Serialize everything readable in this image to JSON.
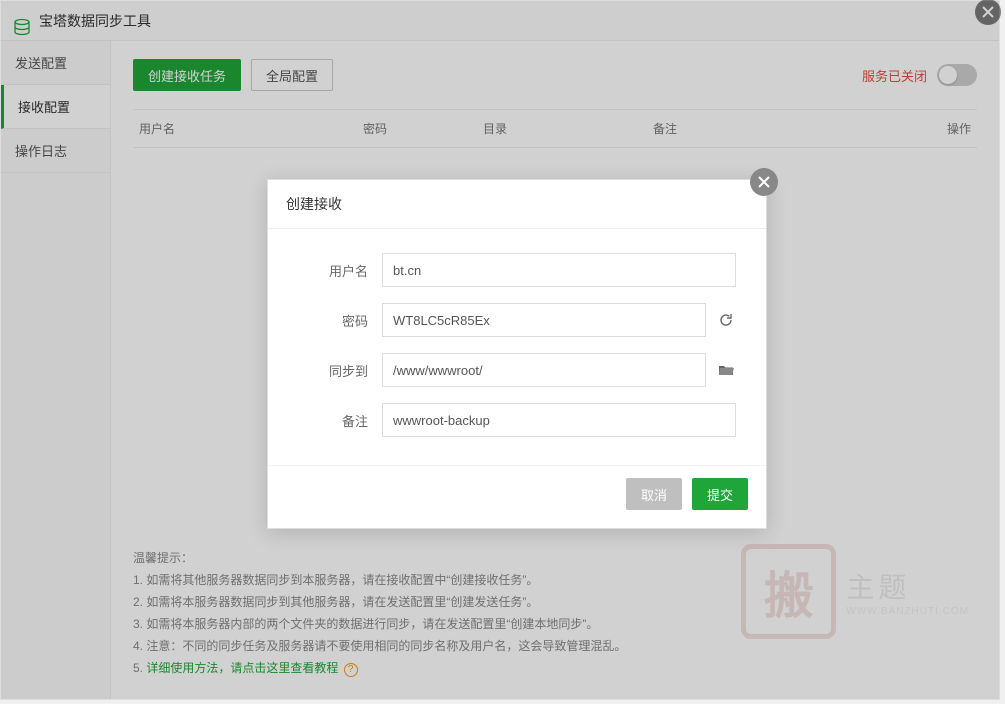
{
  "header": {
    "title": "宝塔数据同步工具"
  },
  "sidebar": {
    "tabs": [
      {
        "label": "发送配置"
      },
      {
        "label": "接收配置"
      },
      {
        "label": "操作日志"
      }
    ]
  },
  "toolbar": {
    "create_task": "创建接收任务",
    "global_config": "全局配置",
    "status_text": "服务已关闭"
  },
  "table": {
    "headers": {
      "user": "用户名",
      "password": "密码",
      "dir": "目录",
      "remark": "备注",
      "op": "操作"
    }
  },
  "tips": {
    "title": "温馨提示：",
    "t1": "1. 如需将其他服务器数据同步到本服务器，请在接收配置中“创建接收任务”。",
    "t2": "2. 如需将本服务器数据同步到其他服务器，请在发送配置里“创建发送任务”。",
    "t3": "3. 如需将本服务器内部的两个文件夹的数据进行同步，请在发送配置里“创建本地同步”。",
    "t4": "4. 注意：不同的同步任务及服务器请不要使用相同的同步名称及用户名，这会导致管理混乱。",
    "t5a": "5. ",
    "t5_link": "详细使用方法，请点击这里查看教程",
    "help": "?"
  },
  "watermark": {
    "seal": "搬",
    "text": "主题",
    "sub": "WWW.BANZHUTI.COM"
  },
  "modal": {
    "title": "创建接收",
    "labels": {
      "user": "用户名",
      "password": "密码",
      "sync_to": "同步到",
      "remark": "备注"
    },
    "values": {
      "user": "bt.cn",
      "password": "WT8LC5cR85Ex",
      "sync_to": "/www/wwwroot/",
      "remark": "wwwroot-backup"
    },
    "buttons": {
      "cancel": "取消",
      "submit": "提交"
    }
  }
}
